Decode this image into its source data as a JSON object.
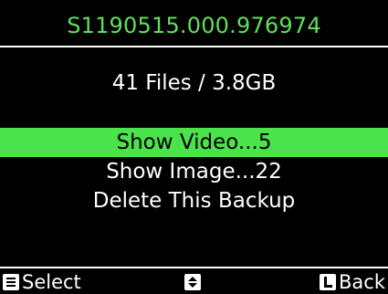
{
  "header": {
    "backup_name": "S1190515.000.976974"
  },
  "summary": {
    "text": "41 Files / 3.8GB"
  },
  "menu": {
    "items": [
      {
        "label": "Show Video...5",
        "selected": true
      },
      {
        "label": "Show Image...22",
        "selected": false
      },
      {
        "label": "Delete This Backup",
        "selected": false
      }
    ]
  },
  "footer": {
    "select_label": "Select",
    "back_label": "Back",
    "select_icon": "menu-key-icon",
    "nav_icon": "up-down-key-icon",
    "back_icon": "l-key-icon"
  },
  "colors": {
    "title": "#5fe05a",
    "highlight": "#4be34b",
    "background": "#000000",
    "text": "#ffffff"
  }
}
